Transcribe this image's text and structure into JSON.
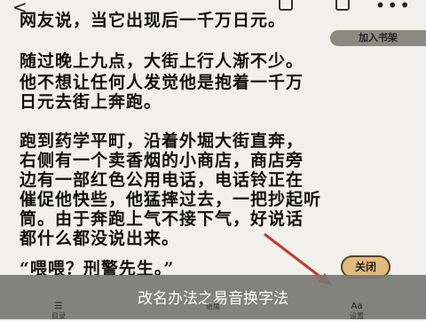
{
  "topbar": {
    "back_glyph": "<",
    "more_glyph": "•••"
  },
  "reader": {
    "lines": [
      "网友说，当它出现后一千万日元。",
      "随过晚上九点，大街上行人渐不少。",
      "他不想让任何人发觉他是抱着一千万",
      "日元去街上奔跑。",
      "跑到药学平町，沿着外堀大街直奔，",
      "右侧有一个卖香烟的小商店，商店旁",
      "边有一部红色公用电话，电话铃正在",
      "催促他快些，他猛摔过去，一把抄起听",
      "筒。由于奔跑上气不接下气，好说话",
      "都什么都没说出来。",
      "“喂喂？刑警先生。”"
    ]
  },
  "bookmark_button": {
    "label": "加入书架"
  },
  "close_button": {
    "label": "关闭"
  },
  "overlay": {
    "caption": "改名办法之易音换字法"
  },
  "tabs": [
    {
      "label": "目录",
      "icon": "list-icon",
      "glyph": "☰"
    },
    {
      "label": "进度",
      "icon": "progress-icon",
      "glyph": ""
    },
    {
      "label": "设置",
      "icon": "font-icon",
      "glyph": "Aa"
    }
  ],
  "colors": {
    "page_bg": "#f1f0ec",
    "text": "#111111",
    "overlay_bg": "#787874",
    "close_button_bg": "#e2bb7f",
    "arrow": "#c0392b"
  }
}
